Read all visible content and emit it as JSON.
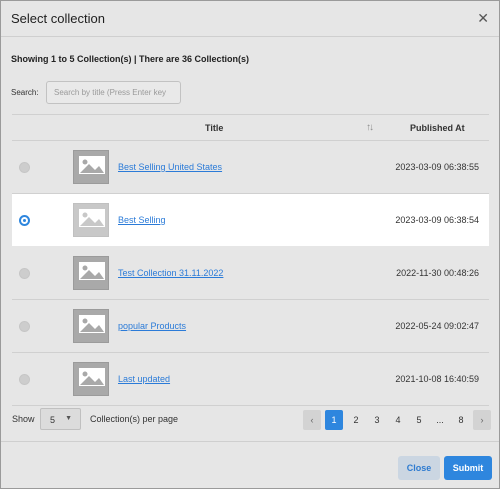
{
  "modal": {
    "title": "Select collection",
    "close_icon": "close-icon"
  },
  "summary": "Showing 1 to 5 Collection(s) | There are 36 Collection(s)",
  "search": {
    "label": "Search:",
    "placeholder": "Search by title (Press Enter key",
    "value": ""
  },
  "table": {
    "columns": {
      "title": "Title",
      "sort_icon": "sort-arrows-icon",
      "published": "Published At"
    },
    "rows": [
      {
        "title": "Best Selling United States",
        "published": "2023-03-09 06:38:55",
        "selected": false
      },
      {
        "title": "Best Selling",
        "published": "2023-03-09 06:38:54",
        "selected": true
      },
      {
        "title": "Test Collection 31.11.2022",
        "published": "2022-11-30 00:48:26",
        "selected": false
      },
      {
        "title": "popular Products",
        "published": "2022-05-24 09:02:47",
        "selected": false
      },
      {
        "title": "Last updated",
        "published": "2021-10-08 16:40:59",
        "selected": false
      }
    ]
  },
  "pagination": {
    "show_label": "Show",
    "page_size": "5",
    "per_page_label": "Collection(s) per page",
    "prev": "‹",
    "next": "›",
    "pages": [
      "1",
      "2",
      "3",
      "4",
      "5",
      "...",
      "8"
    ],
    "active_page": "1"
  },
  "footer": {
    "close_label": "Close",
    "submit_label": "Submit"
  },
  "colors": {
    "accent": "#2e86de",
    "link": "#2b7bd8"
  }
}
